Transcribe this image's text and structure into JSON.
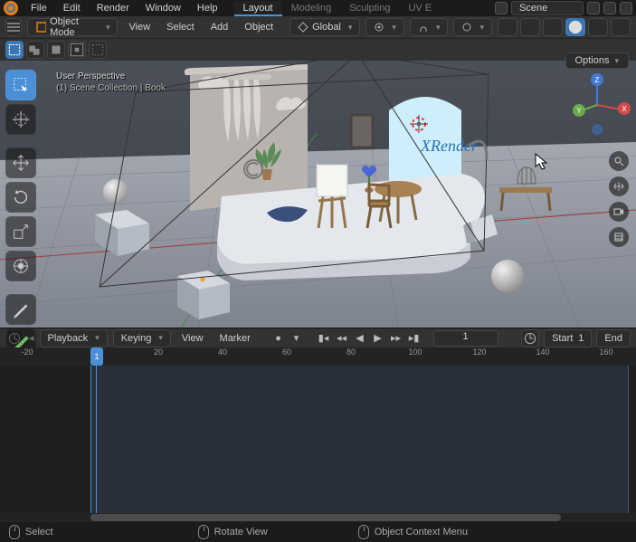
{
  "top_menu": {
    "file": "File",
    "edit": "Edit",
    "render": "Render",
    "window": "Window",
    "help": "Help"
  },
  "workspace_tabs": {
    "layout": "Layout",
    "modeling": "Modeling",
    "sculpting": "Sculpting",
    "uv": "UV E"
  },
  "scene_name": "Scene",
  "header": {
    "mode": "Object Mode",
    "view": "View",
    "select": "Select",
    "add": "Add",
    "object": "Object",
    "orientation": "Global"
  },
  "viewport": {
    "perspective_label": "User Perspective",
    "collection_label": "(1) Scene Collection | Book",
    "render_logo_text": "XRender",
    "options_label": "Options",
    "axes": {
      "x": "X",
      "y": "Y",
      "z": "Z"
    }
  },
  "timeline": {
    "playback": "Playback",
    "keying": "Keying",
    "view": "View",
    "marker": "Marker",
    "current_frame": "1",
    "start_label": "Start",
    "start_value": "1",
    "end_label": "End",
    "ticks": [
      "-20",
      "1",
      "20",
      "40",
      "60",
      "80",
      "100",
      "120",
      "140",
      "160"
    ]
  },
  "status": {
    "select": "Select",
    "rotate": "Rotate View",
    "context": "Object Context Menu"
  }
}
